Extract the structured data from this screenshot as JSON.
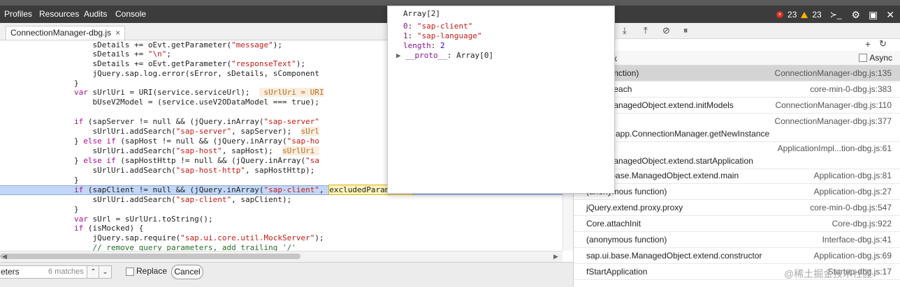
{
  "menubar": {
    "items": [
      "Profiles",
      "Resources",
      "Audits",
      "Console"
    ],
    "error_count": "23",
    "warning_count": "23"
  },
  "editor": {
    "tab_label": "ConnectionManager-dbg.js",
    "tab_close": "×",
    "lines": [
      [
        {
          "t": "                    sDetails += oEvt.getParameter("
        },
        {
          "t": "\"message\"",
          "c": "str"
        },
        {
          "t": ");"
        }
      ],
      [
        {
          "t": "                    sDetails += "
        },
        {
          "t": "\"\\n\"",
          "c": "str"
        },
        {
          "t": ";"
        }
      ],
      [
        {
          "t": "                    sDetails += oEvt.getParameter("
        },
        {
          "t": "\"responseText\"",
          "c": "str"
        },
        {
          "t": ");"
        }
      ],
      [
        {
          "t": "                    jQuery.sap.log.error(sError, sDetails, sComponent"
        }
      ],
      [
        {
          "t": "                }"
        }
      ],
      [
        {
          "t": "                "
        },
        {
          "t": "var",
          "c": "kw"
        },
        {
          "t": " sUrlUri = URI(service.serviceUrl);  "
        },
        {
          "t": " sUrlUri = URI",
          "c": "hint"
        }
      ],
      [
        {
          "t": "                    bUseV2Model = (service.useV2ODataModel === true);"
        }
      ],
      [
        {
          "t": ""
        }
      ],
      [
        {
          "t": "                "
        },
        {
          "t": "if",
          "c": "kw"
        },
        {
          "t": " (sapServer != null && (jQuery.inArray("
        },
        {
          "t": "\"sap-server\"",
          "c": "str"
        }
      ],
      [
        {
          "t": "                    sUrlUri.addSearch("
        },
        {
          "t": "\"sap-server\"",
          "c": "str"
        },
        {
          "t": ", sapServer);  "
        },
        {
          "t": "sUrl",
          "c": "hint"
        }
      ],
      [
        {
          "t": "                } "
        },
        {
          "t": "else if",
          "c": "kw"
        },
        {
          "t": " (sapHost != null && (jQuery.inArray("
        },
        {
          "t": "\"sap-ho",
          "c": "str"
        }
      ],
      [
        {
          "t": "                    sUrlUri.addSearch("
        },
        {
          "t": "\"sap-host\"",
          "c": "str"
        },
        {
          "t": ", sapHost);  "
        },
        {
          "t": "sUrlUri ",
          "c": "hint"
        }
      ],
      [
        {
          "t": "                } "
        },
        {
          "t": "else if",
          "c": "kw"
        },
        {
          "t": " (sapHostHttp != null && (jQuery.inArray("
        },
        {
          "t": "\"sa",
          "c": "str"
        }
      ],
      [
        {
          "t": "                    sUrlUri.addSearch("
        },
        {
          "t": "\"sap-host-http\"",
          "c": "str"
        },
        {
          "t": ", sapHostHttp);"
        }
      ],
      [
        {
          "t": "                }"
        }
      ],
      [
        {
          "t": "                "
        },
        {
          "t": "if",
          "c": "kw"
        },
        {
          "t": " (sapClient != null && (jQuery.inArray("
        },
        {
          "t": "\"sap-client\"",
          "c": "str"
        },
        {
          "t": ", "
        },
        {
          "t": "excludedParameters",
          "c": "match"
        },
        {
          "t": ") == -1)) {"
        }
      ],
      [
        {
          "t": "                    sUrlUri.addSearch("
        },
        {
          "t": "\"sap-client\"",
          "c": "str"
        },
        {
          "t": ", sapClient);"
        }
      ],
      [
        {
          "t": "                }"
        }
      ],
      [
        {
          "t": "                "
        },
        {
          "t": "var",
          "c": "kw"
        },
        {
          "t": " sUrl = sUrlUri.toString();"
        }
      ],
      [
        {
          "t": "                "
        },
        {
          "t": "if",
          "c": "kw"
        },
        {
          "t": " (isMocked) {"
        }
      ],
      [
        {
          "t": "                    jQuery.sap.require("
        },
        {
          "t": "\"sap.ui.core.util.MockServer\"",
          "c": "str"
        },
        {
          "t": ");"
        }
      ],
      [
        {
          "t": "                    // remove query parameters, add trailing '/'",
          "c": "cm"
        }
      ]
    ]
  },
  "findbar": {
    "query": "eters",
    "match_count": "6 matches",
    "prev_glyph": "⌃",
    "next_glyph": "⌄",
    "replace_label": "Replace",
    "cancel_label": "Cancel"
  },
  "popover": {
    "title": "Array[2]",
    "entries": [
      [
        {
          "t": "0",
          "c": "pk"
        },
        {
          "t": ": "
        },
        {
          "t": "\"sap-client\"",
          "c": "ps"
        }
      ],
      [
        {
          "t": "1",
          "c": "pk"
        },
        {
          "t": ": "
        },
        {
          "t": "\"sap-language\"",
          "c": "ps"
        }
      ],
      [
        {
          "t": "length",
          "c": "pk"
        },
        {
          "t": ": "
        },
        {
          "t": "2",
          "c": "pn"
        }
      ],
      [
        {
          "t": "▶ ",
          "c": "arrow"
        },
        {
          "t": "__proto__",
          "c": "pk"
        },
        {
          "t": ": Array[0]"
        }
      ]
    ]
  },
  "callstack": {
    "title": "ck",
    "async_label": "Async",
    "frames": [
      {
        "fn": "nous function)",
        "loc": "ConnectionManager-dbg.js:135",
        "selected": true
      },
      {
        "fn": "extend.each",
        "loc": "core-min-0-dbg.js:383"
      },
      {
        "fn": "base.ManagedObject.extend.initModels",
        "loc": "ConnectionManager-dbg.js:110"
      },
      {
        "fn": "cfld.md.app.ConnectionManager.getNewInstance",
        "loc": "ConnectionManager-dbg.js:377",
        "two": true
      },
      {
        "fn": "base.ManagedObject.extend.startApplication",
        "loc": "ApplicationImpl...tion-dbg.js:61",
        "two": true
      },
      {
        "fn": "sap.ui.base.ManagedObject.extend.main",
        "loc": "Application-dbg.js:81"
      },
      {
        "fn": "(anonymous function)",
        "loc": "Application-dbg.js:27"
      },
      {
        "fn": "jQuery.extend.proxy.proxy",
        "loc": "core-min-0-dbg.js:547"
      },
      {
        "fn": "Core.attachInit",
        "loc": "Core-dbg.js:922"
      },
      {
        "fn": "(anonymous function)",
        "loc": "Interface-dbg.js:41"
      },
      {
        "fn": "sap.ui.base.ManagedObject.extend.constructor",
        "loc": "Application-dbg.js:69"
      },
      {
        "fn": "fStartApplication",
        "loc": "Startup-dbg.js:17"
      }
    ]
  },
  "watermark": "@稀土掘金技术社区",
  "colors": {
    "menubar_bg": "#3c3c3c",
    "highlight_line": "#c2d7f7",
    "keyword": "#aa0d91",
    "string": "#c41a16",
    "selected_frame": "#d4d4d4"
  }
}
